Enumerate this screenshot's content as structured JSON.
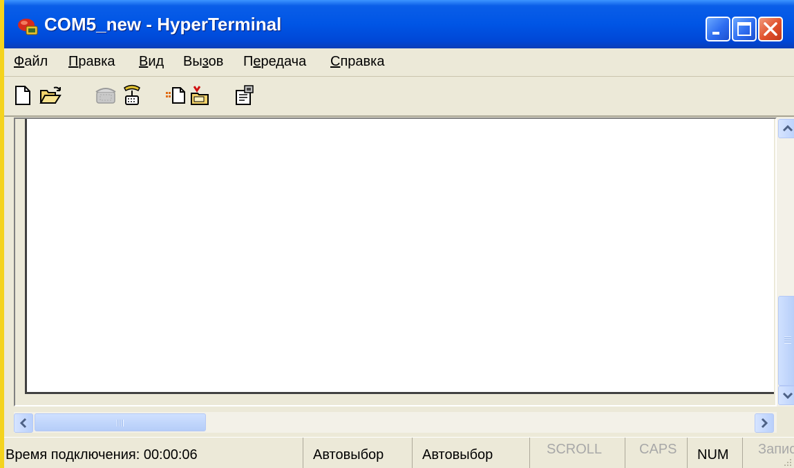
{
  "window": {
    "title": "COM5_new - HyperTerminal",
    "accent": "#0055e5",
    "close_color": "#e0502c"
  },
  "menubar": {
    "items": [
      {
        "pre": "",
        "key": "Ф",
        "post": "айл"
      },
      {
        "pre": "",
        "key": "П",
        "post": "равка"
      },
      {
        "pre": "",
        "key": "В",
        "post": "ид"
      },
      {
        "pre": "Вы",
        "key": "з",
        "post": "ов"
      },
      {
        "pre": "П",
        "key": "е",
        "post": "редача"
      },
      {
        "pre": "",
        "key": "С",
        "post": "правка"
      }
    ]
  },
  "toolbar": {
    "icons": [
      "new-document-icon",
      "open-folder-icon",
      "call-phone-icon",
      "disconnect-phone-icon",
      "send-file-icon",
      "receive-file-icon",
      "properties-icon"
    ]
  },
  "statusbar": {
    "connection_time": "Время подключения: 00:00:06",
    "panel2": "Автовыбор",
    "panel3": "Автовыбор",
    "scroll": "SCROLL",
    "caps": "CAPS",
    "num": "NUM",
    "capture": "Запис"
  }
}
